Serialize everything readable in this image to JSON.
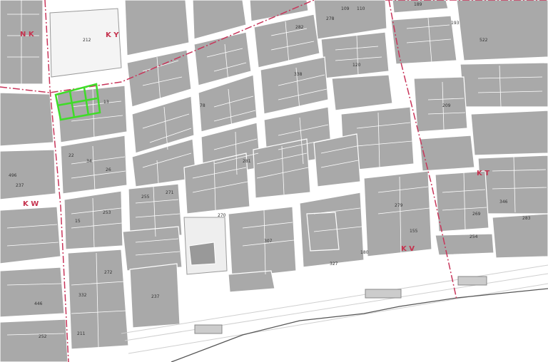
{
  "map": {
    "district_codes": [
      "N K",
      "K Y",
      "K T",
      "K W",
      "K V"
    ],
    "lot_numbers": [
      "212",
      "109",
      "110",
      "189",
      "278",
      "282",
      "193",
      "522",
      "120",
      "338",
      "209",
      "13",
      "78",
      "496",
      "237",
      "22",
      "34",
      "26",
      "281",
      "253",
      "279",
      "15",
      "155",
      "269",
      "254",
      "346",
      "283",
      "180",
      "270",
      "307",
      "327",
      "272",
      "237",
      "332",
      "446",
      "252",
      "211",
      "255",
      "271"
    ],
    "highlight_color": "#3fdc28",
    "boundary_color": "#c5324e",
    "block_color": "#a9a9a9"
  }
}
